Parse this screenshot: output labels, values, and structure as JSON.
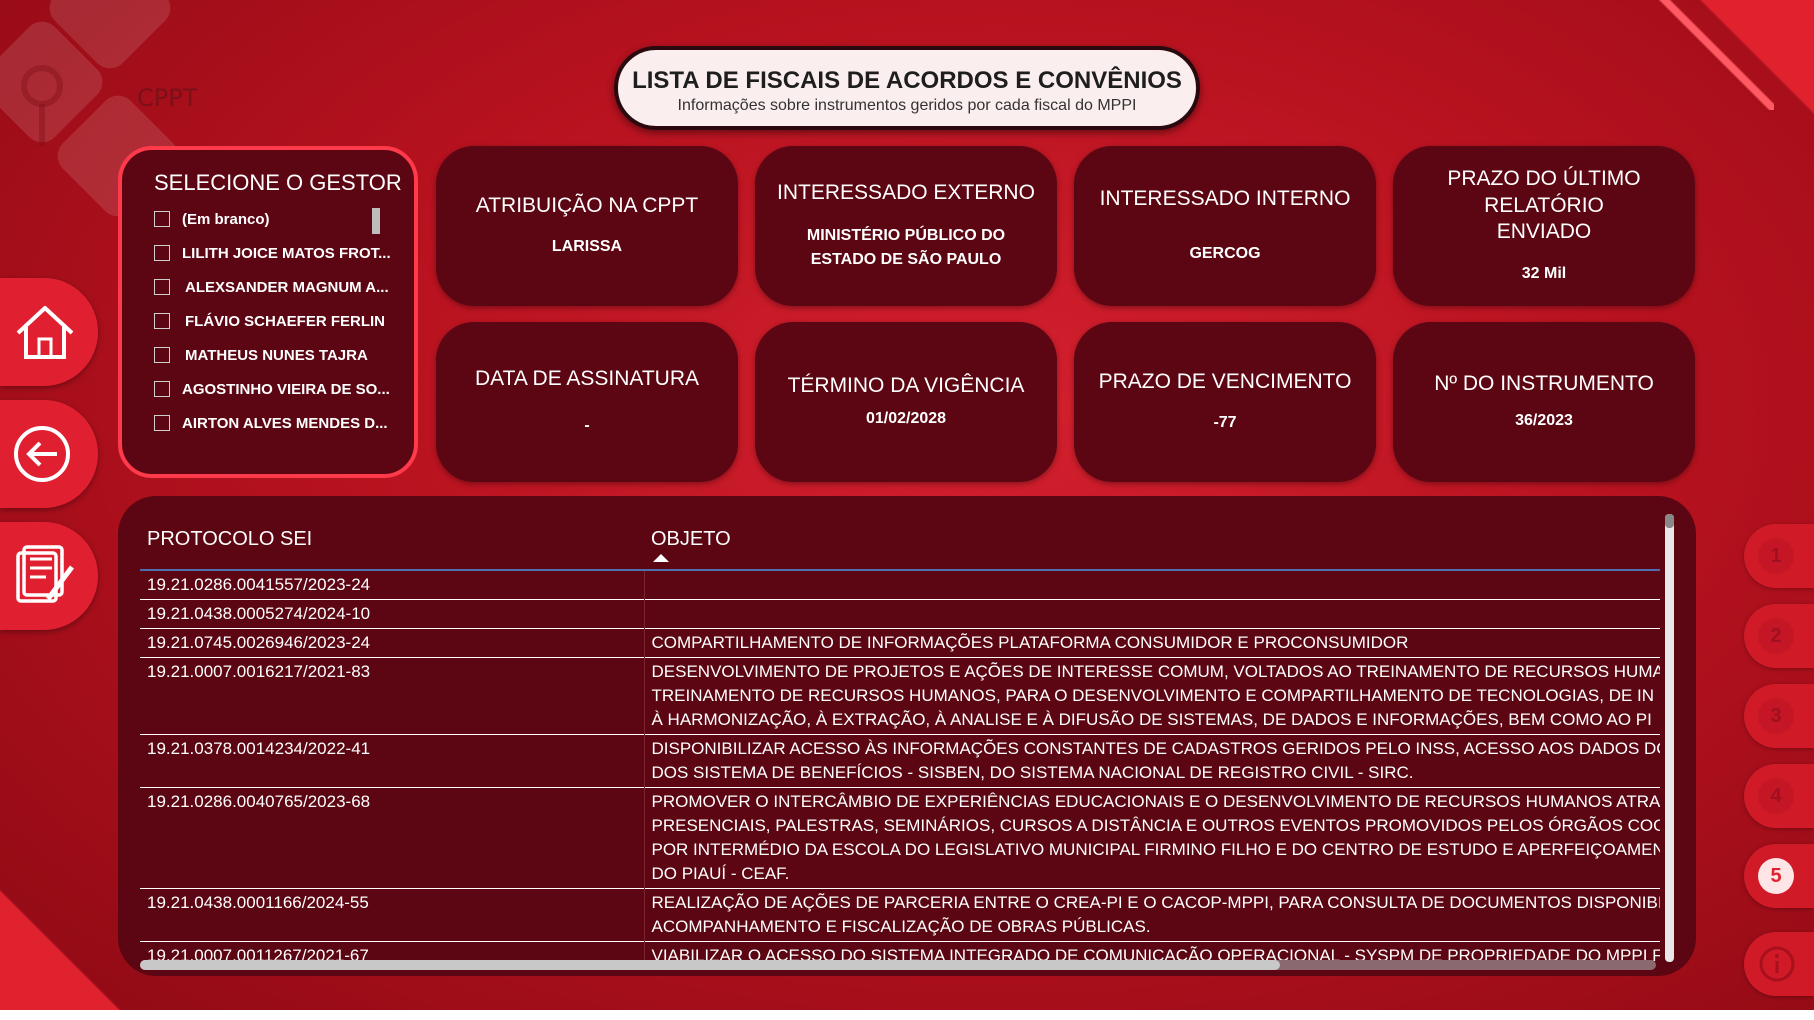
{
  "header": {
    "title": "LISTA DE FISCAIS DE ACORDOS E CONVÊNIOS",
    "subtitle": "Informações sobre instrumentos geridos por cada fiscal do MPPI",
    "section_label": "CPPT"
  },
  "nav": {
    "home_icon": "home-icon",
    "back_icon": "back-arrow-icon",
    "report_icon": "document-pen-icon"
  },
  "pager": {
    "pages": [
      "1",
      "2",
      "3",
      "4",
      "5"
    ],
    "active": "5",
    "info_icon": "info-icon"
  },
  "slicer": {
    "title": "SELECIONE O GESTOR",
    "items": [
      "(Em branco)",
      "LILITH JOICE MATOS FROT...",
      "ALEXSANDER MAGNUM A...",
      "FLÁVIO SCHAEFER FERLIN",
      "MATHEUS NUNES TAJRA",
      "AGOSTINHO VIEIRA DE SO...",
      "AIRTON ALVES MENDES D..."
    ]
  },
  "cards": {
    "atribuicao": {
      "label": "ATRIBUIÇÃO NA CPPT",
      "value": "LARISSA"
    },
    "externo": {
      "label": "INTERESSADO EXTERNO",
      "value": "MINISTÉRIO PÚBLICO DO ESTADO DE SÃO PAULO"
    },
    "interno": {
      "label": "INTERESSADO INTERNO",
      "value": "GERCOG"
    },
    "prazo_relatorio": {
      "label": "PRAZO DO ÚLTIMO RELATÓRIO ENVIADO",
      "value": "32 Mil"
    },
    "assinatura": {
      "label": "DATA DE ASSINATURA",
      "value": "-"
    },
    "termino": {
      "label": "TÉRMINO DA VIGÊNCIA",
      "value": "01/02/2028"
    },
    "vencimento": {
      "label": "PRAZO DE VENCIMENTO",
      "value": "-77"
    },
    "instrumento": {
      "label": "Nº DO INSTRUMENTO",
      "value": "36/2023"
    }
  },
  "table": {
    "columns": [
      "PROTOCOLO SEI",
      "OBJETO"
    ],
    "rows": [
      {
        "protocolo": "19.21.0286.0041557/2023-24",
        "objeto": [
          ""
        ]
      },
      {
        "protocolo": "19.21.0438.0005274/2024-10",
        "objeto": [
          ""
        ]
      },
      {
        "protocolo": "19.21.0745.0026946/2023-24",
        "objeto": [
          "COMPARTILHAMENTO DE INFORMAÇÕES PLATAFORMA CONSUMIDOR E PROCONSUMIDOR"
        ]
      },
      {
        "protocolo": "19.21.0007.0016217/2021-83",
        "objeto": [
          "DESENVOLVIMENTO DE PROJETOS E AÇÕES DE INTERESSE COMUM, VOLTADOS AO TREINAMENTO DE RECURSOS HUMA",
          "TREINAMENTO DE RECURSOS HUMANOS, PARA O DESENVOLVIMENTO E COMPARTILHAMENTO DE TECNOLOGIAS, DE IN",
          "À HARMONIZAÇÃO, À EXTRAÇÃO, À ANALISE E À DIFUSÃO DE SISTEMAS, DE DADOS E INFORMAÇÕES, BEM COMO AO PI"
        ]
      },
      {
        "protocolo": "19.21.0378.0014234/2022-41",
        "objeto": [
          "DISPONIBILIZAR ACESSO ÀS INFORMAÇÕES CONSTANTES DE CADASTROS GERIDOS PELO INSS, ACESSO AOS DADOS DO",
          "DOS SISTEMA DE BENEFÍCIOS - SISBEN, DO SISTEMA NACIONAL DE REGISTRO CIVIL - SIRC."
        ]
      },
      {
        "protocolo": "19.21.0286.0040765/2023-68",
        "objeto": [
          "PROMOVER O INTERCÂMBIO DE EXPERIÊNCIAS EDUCACIONAIS E O DESENVOLVIMENTO DE RECURSOS HUMANOS ATRA",
          "PRESENCIAIS, PALESTRAS, SEMINÁRIOS, CURSOS A DISTÂNCIA E OUTROS EVENTOS PROMOVIDOS PELOS ÓRGÃOS COOP",
          "POR INTERMÉDIO DA ESCOLA DO LEGISLATIVO MUNICIPAL FIRMINO FILHO E DO CENTRO DE ESTUDO E APERFEIÇOAMEN",
          "DO PIAUÍ - CEAF."
        ]
      },
      {
        "protocolo": "19.21.0438.0001166/2024-55",
        "objeto": [
          "REALIZAÇÃO DE AÇÕES DE PARCERIA ENTRE O CREA-PI E O CACOP-MPPI, PARA CONSULTA DE DOCUMENTOS DISPONIBIL",
          "ACOMPANHAMENTO E FISCALIZAÇÃO DE OBRAS PÚBLICAS."
        ]
      },
      {
        "protocolo": "19.21.0007.0011267/2021-67",
        "objeto": [
          "VIABILIZAR O ACESSO DO SISTEMA INTEGRADO DE COMUNICAÇÃO OPERACIONAL - SYSPM DE PROPRIEDADE DO MPPI F"
        ]
      }
    ]
  }
}
